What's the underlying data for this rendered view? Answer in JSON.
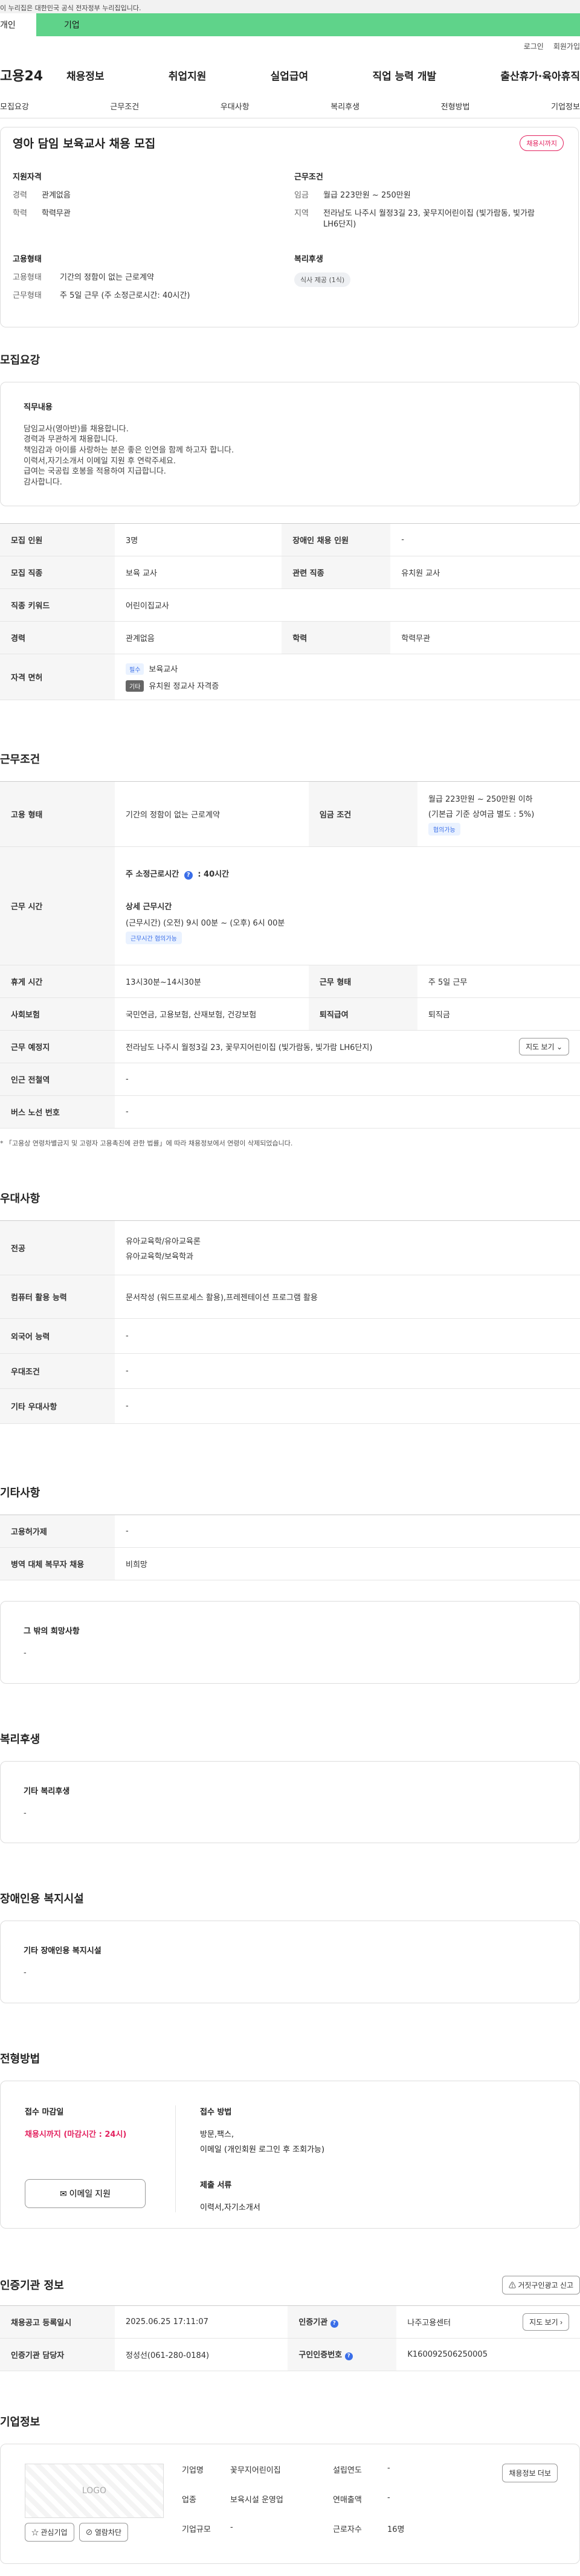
{
  "gov_bar": "이 누리집은 대한민국 공식 전자정부 누리집입니다.",
  "audience": {
    "personal": "개인",
    "company": "기업"
  },
  "util": {
    "login": "로그인",
    "signup": "회원가입"
  },
  "gnb": {
    "logo": "고용24",
    "menu": [
      "채용정보",
      "취업지원",
      "실업급여",
      "직업 능력 개발",
      "출산휴가·육아휴직"
    ]
  },
  "tabs": [
    "모집요강",
    "근무조건",
    "우대사항",
    "복리후생",
    "전형방법",
    "기업정보"
  ],
  "summary": {
    "title": "영아 담임 보육교사 채용 모집",
    "badge": "채용시까지",
    "qual_title": "지원자격",
    "career_k": "경력",
    "career_v": "관계없음",
    "edu_k": "학력",
    "edu_v": "학력무관",
    "cond_title": "근무조건",
    "wage_k": "임금",
    "wage_v": "월급 223만원 ~ 250만원",
    "region_k": "지역",
    "region_v": "전라남도 나주시 월정3길 23, 꽃무지어린이집 (빛가람동, 빛가람 LH6단지)",
    "emp_title": "고용형태",
    "emp_k": "고용형태",
    "emp_v": "기간의 정함이 없는 근로계약",
    "work_k": "근무형태",
    "work_v": "주 5일 근무 (주 소정근로시간: 40시간)",
    "welfare_title": "복리후생",
    "welfare_chip": "식사 제공 (1식)"
  },
  "recruit": {
    "section": "모집요강",
    "duty_title": "직무내용",
    "duty_body": "담임교사(영아반)를 채용합니다.\n경력과 무관하게 채용합니다.\n책임감과 아이를 사랑하는 분은 좋은 인연을 함께 하고자 합니다.\n이력서,자기소개서  이메일 지원 후 연락주세요.\n급여는 국공립 호봉을 적용하여 지급합니다.\n감사합니다.",
    "rows": {
      "count_k": "모집 인원",
      "count_v": "3명",
      "disabled_k": "장애인 채용 인원",
      "disabled_v": "-",
      "job_k": "모집 직종",
      "job_v": "보육 교사",
      "related_k": "관련 직종",
      "related_v": "유치원 교사",
      "keyword_k": "직종 키워드",
      "keyword_v": "어린이집교사",
      "career_k": "경력",
      "career_v": "관계없음",
      "edu_k": "학력",
      "edu_v": "학력무관",
      "license_k": "자격 면허",
      "license_tag1": "필수",
      "license_v1": "보육교사",
      "license_tag2": "기타",
      "license_v2": "유치원 정교사 자격증"
    }
  },
  "work": {
    "section": "근무조건",
    "emp_k": "고용 형태",
    "emp_v": "기간의 정함이 없는 근로계약",
    "wage_k": "임금 조건",
    "wage_v": "월급 223만원 ~ 250만원 이하",
    "wage_note": "(기본급 기준 상여금 별도 : 5%)",
    "wage_chip": "협의가능",
    "hours_k": "근무 시간",
    "hours_total": "주 소정근로시간",
    "hours_total_v": ": 40시간",
    "hours_detail_title": "상세 근무시간",
    "hours_detail_v": "(근무시간) (오전) 9시 00분 ~ (오후) 6시 00분",
    "hours_chip": "근무시간 협의가능",
    "break_k": "휴게 시간",
    "break_v": "13시30분~14시30분",
    "shift_k": "근무 형태",
    "shift_v": "주 5일 근무",
    "insurance_k": "사회보험",
    "insurance_v": "국민연금, 고용보험, 산재보험, 건강보험",
    "retire_k": "퇴직급여",
    "retire_v": "퇴직금",
    "place_k": "근무 예정지",
    "place_v": "전라남도 나주시 월정3길 23, 꽃무지어린이집 (빛가람동, 빛가람 LH6단지)",
    "map_btn": "지도 보기",
    "subway_k": "인근 전철역",
    "subway_v": "-",
    "bus_k": "버스 노선 번호",
    "bus_v": "-",
    "note": "* 「고용상 연령차별금지 및 고령자 고용촉진에 관한 법률」에 따라 채용정보에서 연령이 삭제되었습니다."
  },
  "pref": {
    "section": "우대사항",
    "major_k": "전공",
    "major_v1": "유아교육학/유아교육론",
    "major_v2": "유아교육학/보육학과",
    "computer_k": "컴퓨터 활용 능력",
    "computer_v": "문서작성 (워드프로세스 활용),프레젠테이션 프로그램 활용",
    "lang_k": "외국어 능력",
    "lang_v": "-",
    "cond_k": "우대조건",
    "cond_v": "-",
    "etc_k": "기타 우대사항",
    "etc_v": "-"
  },
  "etc": {
    "section": "기타사항",
    "permit_k": "고용허가제",
    "permit_v": "-",
    "military_k": "병역 대체 복무자 채용",
    "military_v": "비희망",
    "other_title": "그 밖의 희망사항",
    "other_v": "-"
  },
  "welfare": {
    "section": "복리후생",
    "title": "기타 복리후생",
    "v": "-"
  },
  "facility": {
    "section": "장애인용 복지시설",
    "title": "기타 장애인용 복지시설",
    "v": "-"
  },
  "apply": {
    "section": "전형방법",
    "deadline_title": "접수 마감일",
    "deadline_v": "채용시까지 (마감시간 : 24시)",
    "method_title": "접수 방법",
    "method_v1": "방문,팩스,",
    "method_v2": "이메일 (개인회원 로그인 후 조회가능)",
    "docs_title": "제출 서류",
    "docs_v": "이력서,자기소개서",
    "email_btn": "이메일 지원"
  },
  "agency": {
    "section": "인증기관 정보",
    "report_btn": "거짓구인광고 신고",
    "reg_k": "채용공고 등록일시",
    "reg_v": "2025.06.25 17:11:07",
    "org_k": "인증기관",
    "org_v": "나주고용센터",
    "map_btn": "지도 보기",
    "staff_k": "인증기관 담당자",
    "staff_v": "정성선(061-280-0184)",
    "id_k": "구인인증번호",
    "id_v": "K160092506250005"
  },
  "company": {
    "section": "기업정보",
    "logo": "LOGO",
    "name_k": "기업명",
    "name_v": "꽃무지어린이집",
    "year_k": "설립연도",
    "year_v": "-",
    "ind_k": "업종",
    "ind_v": "보육시설 운영업",
    "sales_k": "연매출액",
    "sales_v": "-",
    "size_k": "기업규모",
    "size_v": "-",
    "emp_k": "근로자수",
    "emp_v": "16명",
    "info_btn": "채용정보 더보",
    "fav_btn": "관심기업",
    "block_btn": "열람차단"
  }
}
